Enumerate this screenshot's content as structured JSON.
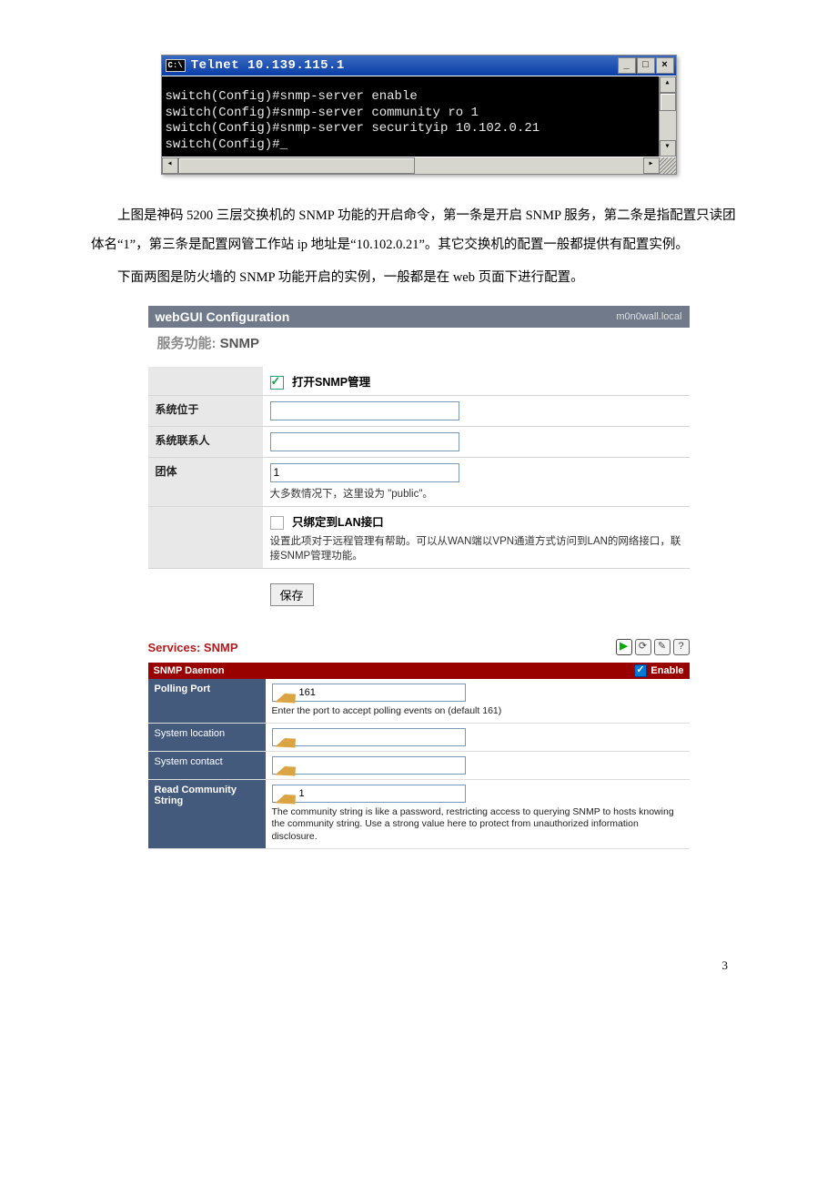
{
  "telnet": {
    "title": "Telnet 10.139.115.1",
    "lines": "switch(Config)#snmp-server enable\nswitch(Config)#snmp-server community ro 1\nswitch(Config)#snmp-server securityip 10.102.0.21\nswitch(Config)#_"
  },
  "para1": "上图是神码 5200 三层交换机的 SNMP 功能的开启命令，第一条是开启 SNMP 服务，第二条是指配置只读团体名“1”，第三条是配置网管工作站 ip 地址是“10.102.0.21”。其它交换机的配置一般都提供有配置实例。",
  "para2": "下面两图是防火墙的 SNMP 功能开启的实例，一般都是在 web 页面下进行配置。",
  "webgui": {
    "header_title": "webGUI Configuration",
    "host": "m0n0wall.local",
    "subtitle_prefix": "服务功能: ",
    "subtitle_bold": "SNMP",
    "enable_label": "打开SNMP管理",
    "rows": {
      "syslocation_label": "系统位于",
      "syscontact_label": "系统联系人",
      "community_label": "团体",
      "community_value": "1",
      "community_hint": "大多数情况下，这里设为 \"public\"。",
      "lan_label": "只绑定到LAN接口",
      "lan_hint": "设置此项对于远程管理有帮助。可以从WAN端以VPN通道方式访问到LAN的网络接口，联接SNMP管理功能。",
      "save_label": "保存"
    }
  },
  "snmp": {
    "section_title": "Services: SNMP",
    "daemon_title": "SNMP Daemon",
    "enable_label": "Enable",
    "rows": {
      "polling_label": "Polling Port",
      "polling_value": "161",
      "polling_hint": "Enter the port to accept polling events on (default 161)",
      "syslocation_label": "System location",
      "syscontact_label": "System contact",
      "community_label": "Read Community String",
      "community_value": "1",
      "community_hint": "The community string is like a password, restricting access to querying SNMP to hosts knowing the community string. Use a strong value here to protect from unauthorized information disclosure."
    }
  },
  "page_number": "3"
}
